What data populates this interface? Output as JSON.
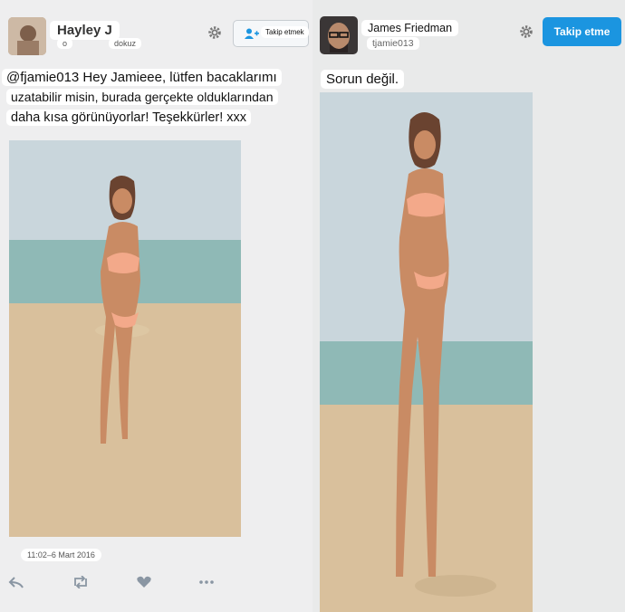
{
  "left": {
    "user_name": "Hayley J",
    "handle_short": "o",
    "handle_word": "dokuz",
    "follow_label": "Takip etmek",
    "tweet_lines": [
      "@fjamie013 Hey Jamieee, lütfen bacaklarımı",
      "uzatabilir misin, burada gerçekte olduklarından",
      "daha kısa görünüyorlar! Teşekkürler! xxx"
    ],
    "timestamp": "11:02–6 Mart 2016",
    "icons": [
      "reply-icon",
      "retweet-icon",
      "like-icon",
      "more-icon"
    ]
  },
  "right": {
    "user_name": "James Friedman",
    "handle": "tjamie013",
    "follow_label": "Takip etme",
    "tweet_text": "Sorun değil."
  },
  "colors": {
    "accent": "#1b95e0",
    "sky": "#c9d6dc",
    "sea": "#8fb9b6",
    "sand": "#d9c09c",
    "bikini": "#f3a98a",
    "skin": "#c98b64"
  }
}
